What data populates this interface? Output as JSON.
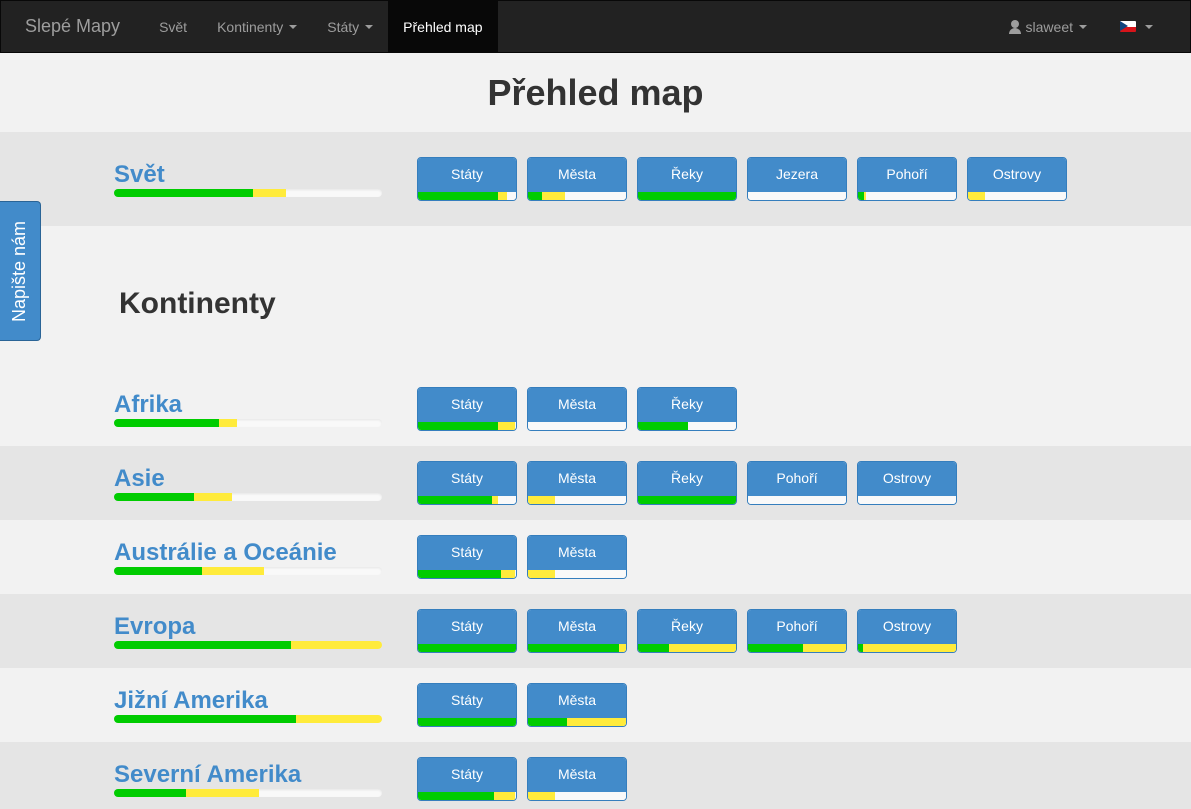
{
  "navbar": {
    "brand": "Slepé Mapy",
    "items": [
      {
        "label": "Svět",
        "dropdown": false,
        "active": false
      },
      {
        "label": "Kontinenty",
        "dropdown": true,
        "active": false
      },
      {
        "label": "Státy",
        "dropdown": true,
        "active": false
      },
      {
        "label": "Přehled map",
        "dropdown": false,
        "active": true
      }
    ],
    "user": "slaweet",
    "language_flag": "cz-flag-icon"
  },
  "page_title": "Přehled map",
  "feedback_label": "Napište nám",
  "world": {
    "name": "Svět",
    "progress": {
      "green": 52,
      "yellow": 12
    },
    "layers": [
      {
        "label": "Státy",
        "green": 82,
        "yellow": 9
      },
      {
        "label": "Města",
        "green": 14,
        "yellow": 24
      },
      {
        "label": "Řeky",
        "green": 100,
        "yellow": 0
      },
      {
        "label": "Jezera",
        "green": 0,
        "yellow": 0
      },
      {
        "label": "Pohoří",
        "green": 6,
        "yellow": 2
      },
      {
        "label": "Ostrovy",
        "green": 0,
        "yellow": 17
      }
    ]
  },
  "continents_title": "Kontinenty",
  "continents": [
    {
      "name": "Afrika",
      "progress": {
        "green": 39,
        "yellow": 7
      },
      "layers": [
        {
          "label": "Státy",
          "green": 82,
          "yellow": 17
        },
        {
          "label": "Města",
          "green": 0,
          "yellow": 0
        },
        {
          "label": "Řeky",
          "green": 51,
          "yellow": 0
        }
      ]
    },
    {
      "name": "Asie",
      "progress": {
        "green": 30,
        "yellow": 14
      },
      "layers": [
        {
          "label": "Státy",
          "green": 75,
          "yellow": 7
        },
        {
          "label": "Města",
          "green": 0,
          "yellow": 28
        },
        {
          "label": "Řeky",
          "green": 100,
          "yellow": 0
        },
        {
          "label": "Pohoří",
          "green": 0,
          "yellow": 0
        },
        {
          "label": "Ostrovy",
          "green": 0,
          "yellow": 0
        }
      ]
    },
    {
      "name": "Austrálie a Oceánie",
      "progress": {
        "green": 33,
        "yellow": 23
      },
      "layers": [
        {
          "label": "Státy",
          "green": 85,
          "yellow": 14
        },
        {
          "label": "Města",
          "green": 0,
          "yellow": 28
        }
      ]
    },
    {
      "name": "Evropa",
      "progress": {
        "green": 66,
        "yellow": 34
      },
      "layers": [
        {
          "label": "Státy",
          "green": 100,
          "yellow": 0
        },
        {
          "label": "Města",
          "green": 93,
          "yellow": 7
        },
        {
          "label": "Řeky",
          "green": 32,
          "yellow": 68
        },
        {
          "label": "Pohoří",
          "green": 56,
          "yellow": 44
        },
        {
          "label": "Ostrovy",
          "green": 5,
          "yellow": 95
        }
      ]
    },
    {
      "name": "Jižní Amerika",
      "progress": {
        "green": 68,
        "yellow": 32
      },
      "layers": [
        {
          "label": "Státy",
          "green": 100,
          "yellow": 0
        },
        {
          "label": "Města",
          "green": 40,
          "yellow": 60
        }
      ]
    },
    {
      "name": "Severní Amerika",
      "progress": {
        "green": 27,
        "yellow": 27
      },
      "layers": [
        {
          "label": "Státy",
          "green": 78,
          "yellow": 21
        },
        {
          "label": "Města",
          "green": 0,
          "yellow": 28
        }
      ]
    }
  ]
}
